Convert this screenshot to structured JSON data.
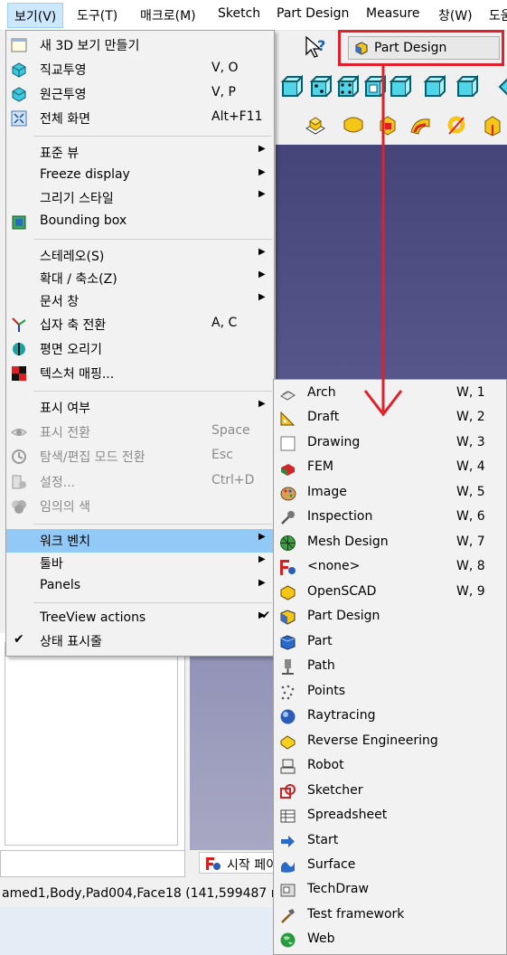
{
  "menubar": {
    "items": [
      "보기(V)",
      "도구(T)",
      "매크로(M)",
      "Sketch",
      "Part Design",
      "Measure",
      "창(W)",
      "도움"
    ]
  },
  "workbench_selector": {
    "value": "Part Design",
    "highlight_color": "#e0202a"
  },
  "view_menu": {
    "items": [
      {
        "label": "새 3D 보기 만들기",
        "shortcut": "",
        "icon": "new-view-icon"
      },
      {
        "label": "직교투영",
        "shortcut": "V, O",
        "icon": "orthographic-cube-icon"
      },
      {
        "label": "원근투영",
        "shortcut": "V, P",
        "icon": "perspective-cube-icon"
      },
      {
        "label": "전체 화면",
        "shortcut": "Alt+F11",
        "icon": "fullscreen-icon"
      },
      {
        "label": "표준 뷰",
        "shortcut": "",
        "submenu": true
      },
      {
        "label": "Freeze display",
        "shortcut": "",
        "submenu": true
      },
      {
        "label": "그리기 스타일",
        "shortcut": "",
        "submenu": true
      },
      {
        "label": "Bounding box",
        "shortcut": "",
        "icon": "bounding-box-icon"
      },
      {
        "label": "스테레오(S)",
        "shortcut": "",
        "submenu": true
      },
      {
        "label": "확대 / 축소(Z)",
        "shortcut": "",
        "submenu": true
      },
      {
        "label": "문서 창",
        "shortcut": "",
        "submenu": true
      },
      {
        "label": "십자 축 전환",
        "shortcut": "A, C",
        "icon": "axis-cross-icon"
      },
      {
        "label": "평면 오리기",
        "shortcut": "",
        "icon": "clipping-plane-icon"
      },
      {
        "label": "텍스처 매핑...",
        "shortcut": "",
        "icon": "texture-mapping-icon"
      },
      {
        "label": "표시 여부",
        "shortcut": "",
        "submenu": true
      },
      {
        "label": "표시 전환",
        "shortcut": "Space",
        "icon": "eye-icon",
        "disabled": true
      },
      {
        "label": "탐색/편집 모드 전환",
        "shortcut": "Esc",
        "icon": "toggle-mode-icon",
        "disabled": true
      },
      {
        "label": "설정...",
        "shortcut": "Ctrl+D",
        "icon": "settings-icon",
        "disabled": true
      },
      {
        "label": "임의의 색",
        "shortcut": "",
        "icon": "random-color-icon",
        "disabled": true
      },
      {
        "label": "워크 벤치",
        "shortcut": "",
        "submenu": true,
        "highlighted": true
      },
      {
        "label": "툴바",
        "shortcut": "",
        "submenu": true
      },
      {
        "label": "Panels",
        "shortcut": "",
        "submenu": true
      },
      {
        "label": "TreeView actions",
        "shortcut": "",
        "submenu": true
      },
      {
        "label": "상태 표시줄",
        "shortcut": "",
        "checked": true
      }
    ]
  },
  "workbench_menu": {
    "items": [
      {
        "label": "Arch",
        "shortcut": "W, 1",
        "icon": "arch-icon"
      },
      {
        "label": "Draft",
        "shortcut": "W, 2",
        "icon": "draft-icon"
      },
      {
        "label": "Drawing",
        "shortcut": "W, 3",
        "icon": "drawing-icon"
      },
      {
        "label": "FEM",
        "shortcut": "W, 4",
        "icon": "fem-icon"
      },
      {
        "label": "Image",
        "shortcut": "W, 5",
        "icon": "image-icon"
      },
      {
        "label": "Inspection",
        "shortcut": "W, 6",
        "icon": "inspection-icon"
      },
      {
        "label": "Mesh Design",
        "shortcut": "W, 7",
        "icon": "mesh-design-icon"
      },
      {
        "label": "<none>",
        "shortcut": "W, 8",
        "icon": "freecad-icon"
      },
      {
        "label": "OpenSCAD",
        "shortcut": "W, 9",
        "icon": "openscad-icon"
      },
      {
        "label": "Part Design",
        "shortcut": "",
        "icon": "part-design-icon",
        "checked": true
      },
      {
        "label": "Part",
        "shortcut": "",
        "icon": "part-icon"
      },
      {
        "label": "Path",
        "shortcut": "",
        "icon": "path-icon"
      },
      {
        "label": "Points",
        "shortcut": "",
        "icon": "points-icon"
      },
      {
        "label": "Raytracing",
        "shortcut": "",
        "icon": "raytracing-icon"
      },
      {
        "label": "Reverse Engineering",
        "shortcut": "",
        "icon": "reverse-engineering-icon"
      },
      {
        "label": "Robot",
        "shortcut": "",
        "icon": "robot-icon"
      },
      {
        "label": "Sketcher",
        "shortcut": "",
        "icon": "sketcher-icon"
      },
      {
        "label": "Spreadsheet",
        "shortcut": "",
        "icon": "spreadsheet-icon"
      },
      {
        "label": "Start",
        "shortcut": "",
        "icon": "start-arrow-icon"
      },
      {
        "label": "Surface",
        "shortcut": "",
        "icon": "surface-icon"
      },
      {
        "label": "TechDraw",
        "shortcut": "",
        "icon": "techdraw-icon"
      },
      {
        "label": "Test framework",
        "shortcut": "",
        "icon": "test-framework-icon"
      },
      {
        "label": "Web",
        "shortcut": "",
        "icon": "web-globe-icon"
      }
    ]
  },
  "tab": {
    "label": "시작 페이"
  },
  "statusbar": {
    "text": "amed1,Body,Pad004,Face18 (141,599487 m"
  }
}
